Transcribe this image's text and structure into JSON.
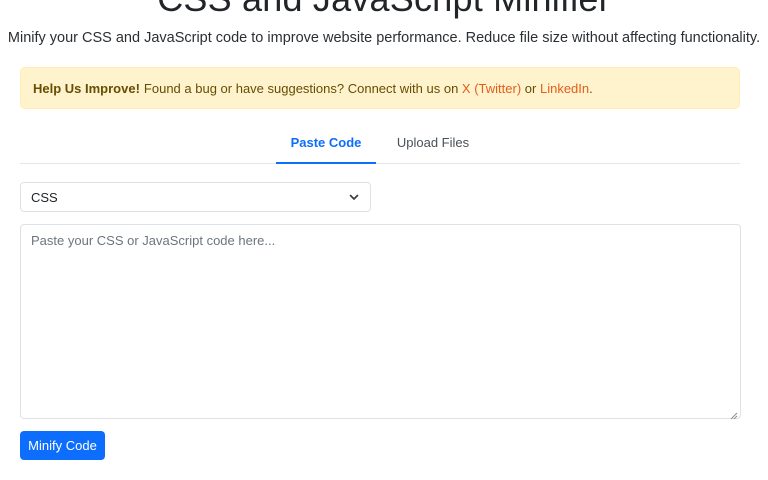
{
  "header": {
    "title": "CSS and JavaScript Minifier",
    "subtitle": "Minify your CSS and JavaScript code to improve website performance. Reduce file size without affecting functionality."
  },
  "notice": {
    "bold": "Help Us Improve!",
    "text": "Found a bug or have suggestions? Connect with us on",
    "link_x": "X (Twitter)",
    "or": "or",
    "link_linkedin": "LinkedIn",
    "end": ".",
    "bg_color": "#fff3cd"
  },
  "tabs": [
    {
      "label": "Paste Code",
      "active": true
    },
    {
      "label": "Upload Files",
      "active": false
    }
  ],
  "language_select": {
    "value": "CSS",
    "icon": "chevron-down-icon"
  },
  "code_input": {
    "value": "",
    "placeholder": "Paste your CSS or JavaScript code here..."
  },
  "actions": {
    "minify_label": "Minify Code"
  },
  "colors": {
    "accent": "#0d6efd",
    "link": "#e35d1b"
  }
}
